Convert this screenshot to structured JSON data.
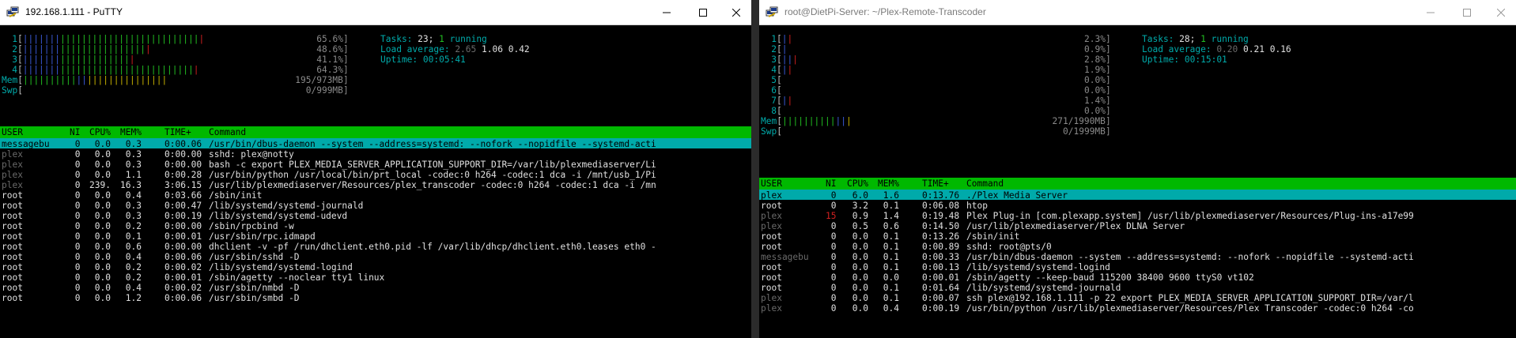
{
  "left": {
    "title": "192.168.1.111 - PuTTY",
    "meters": [
      {
        "label": "1",
        "bar": "||||||||||||||||||||||||||||||||||",
        "pct": "65.6%"
      },
      {
        "label": "2",
        "bar": "||||||||||||||||||||||||",
        "pct": "48.6%"
      },
      {
        "label": "3",
        "bar": "|||||||||||||||||||||",
        "pct": "41.1%"
      },
      {
        "label": "4",
        "bar": "|||||||||||||||||||||||||||||||||",
        "pct": "64.3%"
      },
      {
        "label": "Mem",
        "bar": "|||||||||||||||||||||||||||",
        "pct": "195/973MB"
      },
      {
        "label": "Swp",
        "bar": "",
        "pct": "0/999MB"
      }
    ],
    "tasks_label": "Tasks:",
    "tasks_count": "23;",
    "tasks_running": "1",
    "tasks_running_label": "running",
    "load_label": "Load average:",
    "load1": "2.65",
    "load5": "1.06",
    "load15": "0.42",
    "uptime_label": "Uptime:",
    "uptime": "00:05:41",
    "header": {
      "user": "USER",
      "ni": "NI",
      "cpu": "CPU%",
      "mem": "MEM%",
      "time": "TIME+",
      "cmd": "Command"
    },
    "procs": [
      {
        "user": "messagebu",
        "ni": "0",
        "cpu": "0.0",
        "mem": "0.3",
        "time": "0:00.06",
        "cmd": "/usr/bin/dbus-daemon --system --address=systemd: --nofork --nopidfile --systemd-acti",
        "sel": true
      },
      {
        "user": "plex",
        "ni": "0",
        "cpu": "0.0",
        "mem": "0.3",
        "time": "0:00.00",
        "cmd": "sshd: plex@notty"
      },
      {
        "user": "plex",
        "ni": "0",
        "cpu": "0.0",
        "mem": "0.3",
        "time": "0:00.00",
        "cmd": "bash -c export PLEX_MEDIA_SERVER_APPLICATION_SUPPORT_DIR=/var/lib/plexmediaserver/Li"
      },
      {
        "user": "plex",
        "ni": "0",
        "cpu": "0.0",
        "mem": "1.1",
        "time": "0:00.28",
        "cmd": "/usr/bin/python /usr/local/bin/prt_local -codec:0 h264 -codec:1 dca -i /mnt/usb_1/Pi"
      },
      {
        "user": "plex",
        "ni": "0",
        "cpu": "239.",
        "mem": "16.3",
        "time": "3:06.15",
        "cmd": "/usr/lib/plexmediaserver/Resources/plex_transcoder -codec:0 h264 -codec:1 dca -i /mn"
      },
      {
        "user": "root",
        "ni": "0",
        "cpu": "0.0",
        "mem": "0.4",
        "time": "0:03.66",
        "cmd": "/sbin/init"
      },
      {
        "user": "root",
        "ni": "0",
        "cpu": "0.0",
        "mem": "0.3",
        "time": "0:00.47",
        "cmd": "/lib/systemd/systemd-journald"
      },
      {
        "user": "root",
        "ni": "0",
        "cpu": "0.0",
        "mem": "0.3",
        "time": "0:00.19",
        "cmd": "/lib/systemd/systemd-udevd"
      },
      {
        "user": "root",
        "ni": "0",
        "cpu": "0.0",
        "mem": "0.2",
        "time": "0:00.00",
        "cmd": "/sbin/rpcbind -w"
      },
      {
        "user": "root",
        "ni": "0",
        "cpu": "0.0",
        "mem": "0.1",
        "time": "0:00.01",
        "cmd": "/usr/sbin/rpc.idmapd"
      },
      {
        "user": "root",
        "ni": "0",
        "cpu": "0.0",
        "mem": "0.6",
        "time": "0:00.00",
        "cmd": "dhclient -v -pf /run/dhclient.eth0.pid -lf /var/lib/dhcp/dhclient.eth0.leases eth0 -"
      },
      {
        "user": "root",
        "ni": "0",
        "cpu": "0.0",
        "mem": "0.4",
        "time": "0:00.06",
        "cmd": "/usr/sbin/sshd -D"
      },
      {
        "user": "root",
        "ni": "0",
        "cpu": "0.0",
        "mem": "0.2",
        "time": "0:00.02",
        "cmd": "/lib/systemd/systemd-logind"
      },
      {
        "user": "root",
        "ni": "0",
        "cpu": "0.0",
        "mem": "0.2",
        "time": "0:00.01",
        "cmd": "/sbin/agetty --noclear tty1 linux"
      },
      {
        "user": "root",
        "ni": "0",
        "cpu": "0.0",
        "mem": "0.4",
        "time": "0:00.02",
        "cmd": "/usr/sbin/nmbd -D"
      },
      {
        "user": "root",
        "ni": "0",
        "cpu": "0.0",
        "mem": "1.2",
        "time": "0:00.06",
        "cmd": "/usr/sbin/smbd -D"
      }
    ]
  },
  "right": {
    "title": "root@DietPi-Server: ~/Plex-Remote-Transcoder",
    "meters": [
      {
        "label": "1",
        "bar": "||",
        "pct": "2.3%"
      },
      {
        "label": "2",
        "bar": "|",
        "pct": "0.9%"
      },
      {
        "label": "3",
        "bar": "|||",
        "pct": "2.8%"
      },
      {
        "label": "4",
        "bar": "||",
        "pct": "1.9%"
      },
      {
        "label": "5",
        "bar": "",
        "pct": "0.0%"
      },
      {
        "label": "6",
        "bar": "",
        "pct": "0.0%"
      },
      {
        "label": "7",
        "bar": "||",
        "pct": "1.4%"
      },
      {
        "label": "8",
        "bar": "",
        "pct": "0.0%"
      },
      {
        "label": "Mem",
        "bar": "|||||||||||||",
        "pct": "271/1990MB"
      },
      {
        "label": "Swp",
        "bar": "",
        "pct": "0/1999MB"
      }
    ],
    "tasks_label": "Tasks:",
    "tasks_count": "28;",
    "tasks_running": "1",
    "tasks_running_label": "running",
    "load_label": "Load average:",
    "load1": "0.20",
    "load5": "0.21",
    "load15": "0.16",
    "uptime_label": "Uptime:",
    "uptime": "00:15:01",
    "header": {
      "user": "USER",
      "ni": "NI",
      "cpu": "CPU%",
      "mem": "MEM%",
      "time": "TIME+",
      "cmd": "Command"
    },
    "procs": [
      {
        "user": "plex",
        "ni": "0",
        "cpu": "6.0",
        "mem": "1.6",
        "time": "0:13.76",
        "cmd": "./Plex Media Server",
        "sel": true
      },
      {
        "user": "root",
        "ni": "0",
        "cpu": "3.2",
        "mem": "0.1",
        "time": "0:06.08",
        "cmd": "htop"
      },
      {
        "user": "plex",
        "ni": "15",
        "cpu": "0.9",
        "mem": "1.4",
        "time": "0:19.48",
        "cmd": "Plex Plug-in [com.plexapp.system] /usr/lib/plexmediaserver/Resources/Plug-ins-a17e99"
      },
      {
        "user": "plex",
        "ni": "0",
        "cpu": "0.5",
        "mem": "0.6",
        "time": "0:14.50",
        "cmd": "/usr/lib/plexmediaserver/Plex DLNA Server"
      },
      {
        "user": "root",
        "ni": "0",
        "cpu": "0.0",
        "mem": "0.1",
        "time": "0:13.26",
        "cmd": "/sbin/init"
      },
      {
        "user": "root",
        "ni": "0",
        "cpu": "0.0",
        "mem": "0.1",
        "time": "0:00.89",
        "cmd": "sshd: root@pts/0"
      },
      {
        "user": "messagebu",
        "ni": "0",
        "cpu": "0.0",
        "mem": "0.1",
        "time": "0:00.33",
        "cmd": "/usr/bin/dbus-daemon --system --address=systemd: --nofork --nopidfile --systemd-acti"
      },
      {
        "user": "root",
        "ni": "0",
        "cpu": "0.0",
        "mem": "0.1",
        "time": "0:00.13",
        "cmd": "/lib/systemd/systemd-logind"
      },
      {
        "user": "root",
        "ni": "0",
        "cpu": "0.0",
        "mem": "0.0",
        "time": "0:00.01",
        "cmd": "/sbin/agetty --keep-baud 115200 38400 9600 ttyS0 vt102"
      },
      {
        "user": "root",
        "ni": "0",
        "cpu": "0.0",
        "mem": "0.1",
        "time": "0:01.64",
        "cmd": "/lib/systemd/systemd-journald"
      },
      {
        "user": "plex",
        "ni": "0",
        "cpu": "0.0",
        "mem": "0.1",
        "time": "0:00.07",
        "cmd": "ssh plex@192.168.1.111 -p 22 export PLEX_MEDIA_SERVER_APPLICATION_SUPPORT_DIR=/var/l"
      },
      {
        "user": "plex",
        "ni": "0",
        "cpu": "0.0",
        "mem": "0.4",
        "time": "0:00.19",
        "cmd": "/usr/bin/python /usr/lib/plexmediaserver/Resources/Plex Transcoder -codec:0 h264 -co"
      }
    ]
  },
  "icons": {
    "app": "putty-icon",
    "minimize": "minimize-icon",
    "maximize": "maximize-icon",
    "close": "close-icon"
  }
}
